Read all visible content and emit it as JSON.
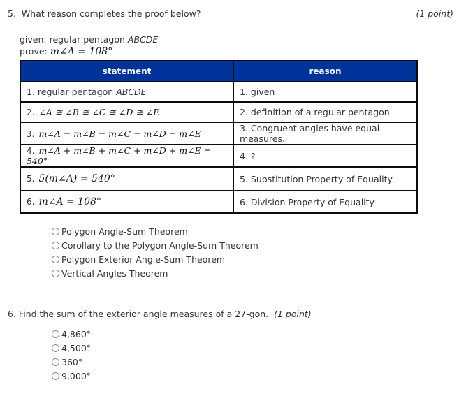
{
  "question5": {
    "number": "5.",
    "prompt": "What reason completes the proof below?",
    "points": "(1 point)",
    "given_label": "given:",
    "given_text": "regular pentagon",
    "given_polygon": "ABCDE",
    "prove_label": "prove:",
    "prove_expr": "m∠A = 108°",
    "table": {
      "headers": [
        "statement",
        "reason"
      ],
      "header_color": "#003399",
      "rows": [
        {
          "statement_num": "1.",
          "statement": "regular pentagon",
          "statement_italic": "ABCDE",
          "reason": "1. given"
        },
        {
          "statement_num": "2.",
          "statement": "∠A ≅ ∠B ≅ ∠C ≅ ∠D ≅ ∠E",
          "reason": "2. definition of a regular pentagon"
        },
        {
          "statement_num": "3.",
          "statement": "m∠A = m∠B = m∠C = m∠D = m∠E",
          "reason": "3. Congruent angles have equal measures."
        },
        {
          "statement_num": "4.",
          "statement": "m∠A + m∠B + m∠C + m∠D + m∠E = 540°",
          "reason": "4. ?"
        },
        {
          "statement_num": "5.",
          "statement": "5(m∠A) = 540°",
          "reason": "5. Substitution Property of Equality"
        },
        {
          "statement_num": "6.",
          "statement": "m∠A = 108°",
          "reason": "6. Division Property of Equality"
        }
      ]
    },
    "options": [
      "Polygon Angle-Sum Theorem",
      "Corollary to the Polygon Angle-Sum Theorem",
      "Polygon Exterior Angle-Sum Theorem",
      "Vertical Angles Theorem"
    ]
  },
  "question6": {
    "number": "6.",
    "prompt": "Find the sum of the exterior angle measures of a 27-gon.",
    "points": "(1 point)",
    "options": [
      "4,860°",
      "4,500°",
      "360°",
      "9,000°"
    ]
  }
}
